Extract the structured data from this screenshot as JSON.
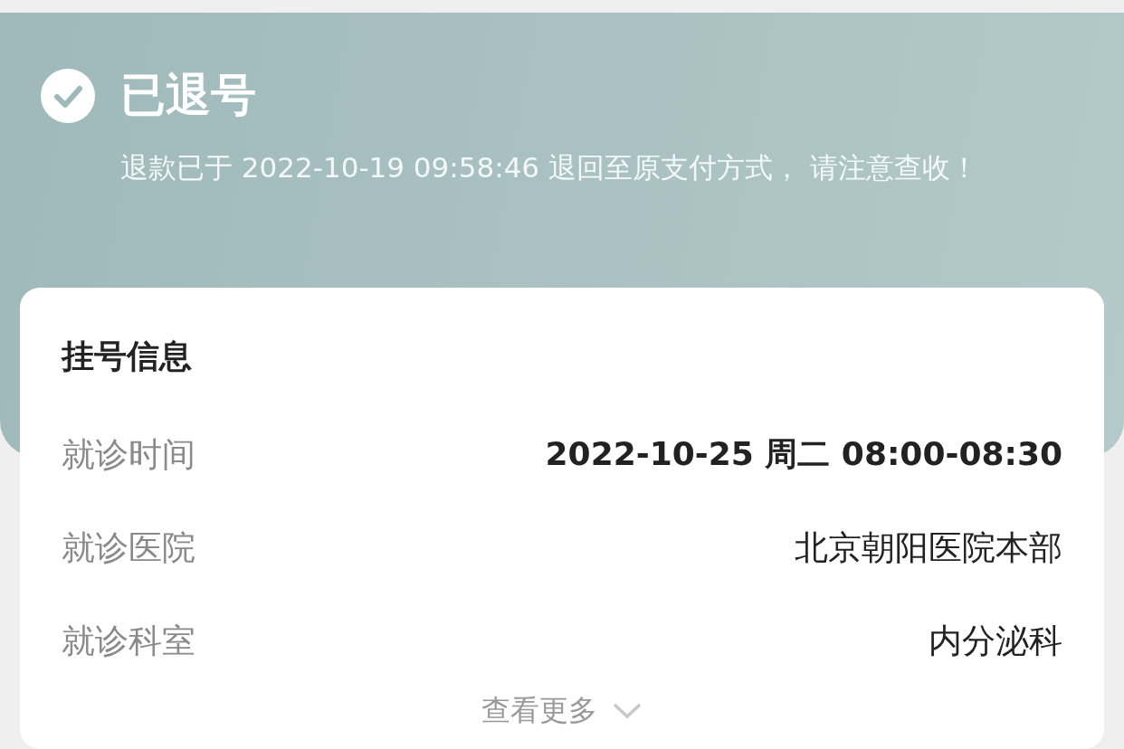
{
  "status": {
    "title": "已退号",
    "message": "退款已于 2022-10-19 09:58:46 退回至原支付方式， 请注意查收！"
  },
  "card": {
    "title": "挂号信息",
    "rows": [
      {
        "label": "就诊时间",
        "value": "2022-10-25 周二 08:00-08:30",
        "emphasis": true
      },
      {
        "label": "就诊医院",
        "value": "北京朝阳医院本部",
        "emphasis": false
      },
      {
        "label": "就诊科室",
        "value": "内分泌科",
        "emphasis": false
      }
    ],
    "more": "查看更多"
  }
}
